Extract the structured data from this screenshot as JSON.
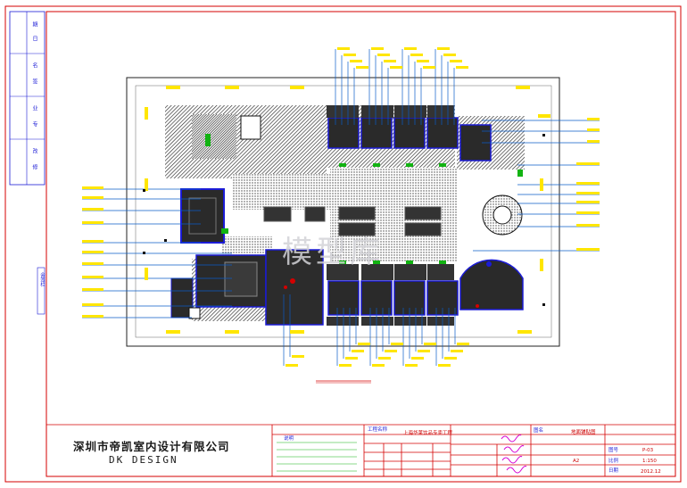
{
  "drawing": {
    "plan_title": "",
    "watermark": "模型库"
  },
  "company": {
    "name_cn": "深圳市帝凯室内设计有限公司",
    "name_en": "DK DESIGN"
  },
  "left_strip": {
    "cells": [
      "期",
      "日",
      "名",
      "签",
      "业",
      "专",
      "改",
      "修"
    ],
    "vertical_label": "会签栏"
  },
  "title_block": {
    "project_label": "工程名称",
    "project_name": "上海华莱饮品专卖工程",
    "drawing_label": "图名",
    "drawing_name": "地面铺贴图",
    "drawing_no_label": "图号",
    "drawing_no": "P-03",
    "scale_label": "比例",
    "scale": "1:150",
    "size": "A2",
    "date_label": "日期",
    "date": "2012.12",
    "notes_label": "说明"
  },
  "colors": {
    "border": "#d40000",
    "wall": "#1b1bd6",
    "leader": "#0a5cc8",
    "tag": "#ffe600",
    "hatch": "#2a2a2a",
    "signature": "#d400d4",
    "green": "#12b312"
  }
}
